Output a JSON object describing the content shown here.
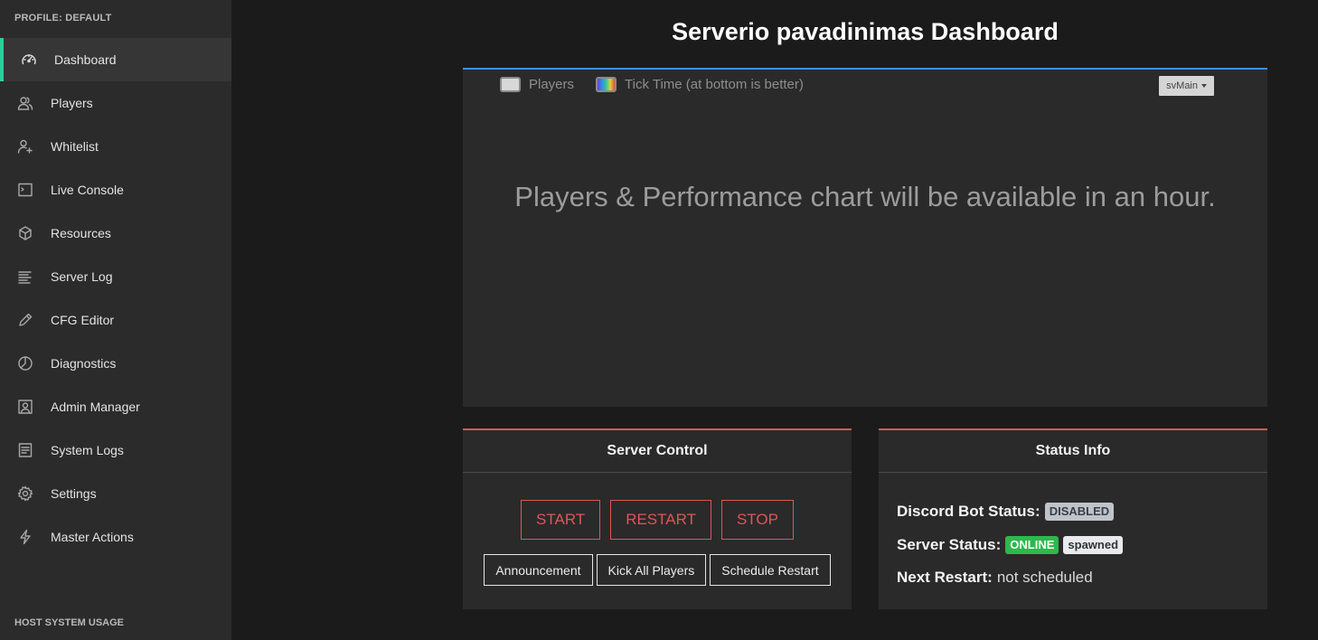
{
  "sidebar": {
    "profile_label": "PROFILE: DEFAULT",
    "host_label": "HOST SYSTEM USAGE",
    "accent_color": "#2bd19a",
    "items": [
      {
        "label": "Dashboard",
        "icon": "speedometer-icon",
        "active": true
      },
      {
        "label": "Players",
        "icon": "users-icon"
      },
      {
        "label": "Whitelist",
        "icon": "user-plus-icon"
      },
      {
        "label": "Live Console",
        "icon": "terminal-icon"
      },
      {
        "label": "Resources",
        "icon": "cube-icon"
      },
      {
        "label": "Server Log",
        "icon": "lines-icon"
      },
      {
        "label": "CFG Editor",
        "icon": "pencil-icon"
      },
      {
        "label": "Diagnostics",
        "icon": "chart-pie-icon"
      },
      {
        "label": "Admin Manager",
        "icon": "contact-icon"
      },
      {
        "label": "System Logs",
        "icon": "file-icon"
      },
      {
        "label": "Settings",
        "icon": "gear-icon"
      },
      {
        "label": "Master Actions",
        "icon": "bolt-icon"
      }
    ]
  },
  "main": {
    "title": "Serverio pavadinimas Dashboard",
    "chart": {
      "legend": [
        {
          "label": "Players"
        },
        {
          "label": "Tick Time (at bottom is better)"
        }
      ],
      "server_select": "svMain",
      "message": "Players & Performance chart will be available in an hour.",
      "accent_color": "#3d8ee8"
    },
    "server_control": {
      "title": "Server Control",
      "start_label": "START",
      "restart_label": "RESTART",
      "stop_label": "STOP",
      "announcement_label": "Announcement",
      "kick_all_label": "Kick All Players",
      "schedule_restart_label": "Schedule Restart",
      "danger_color": "#e05555"
    },
    "status_info": {
      "title": "Status Info",
      "discord_key": "Discord Bot Status:",
      "discord_badge": "DISABLED",
      "server_key": "Server Status:",
      "server_badge_online": "ONLINE",
      "server_badge_state": "spawned",
      "restart_key": "Next Restart:",
      "restart_value": "not scheduled",
      "online_color": "#2eb84c"
    }
  }
}
